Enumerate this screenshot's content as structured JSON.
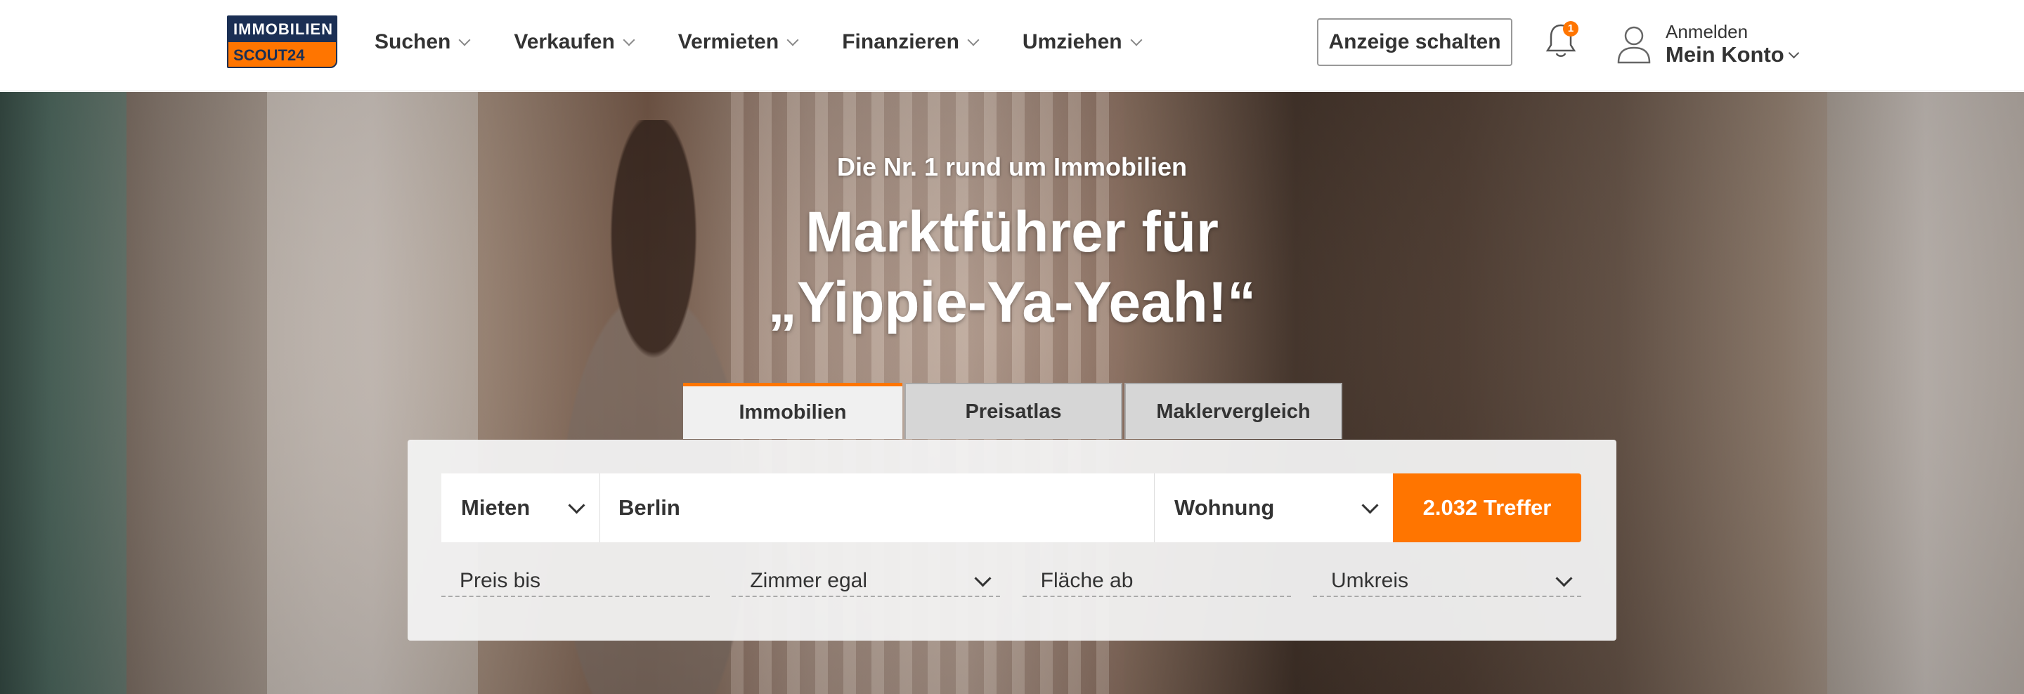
{
  "brand": {
    "logo_line1": "IMMOBILIEN",
    "logo_line2": "SCOUT24",
    "colors": {
      "orange": "#ff7500",
      "navy": "#1b2f54"
    }
  },
  "nav": [
    {
      "label": "Suchen"
    },
    {
      "label": "Verkaufen"
    },
    {
      "label": "Vermieten"
    },
    {
      "label": "Finanzieren"
    },
    {
      "label": "Umziehen"
    }
  ],
  "header": {
    "ad_button": "Anzeige schalten",
    "notification_count": "1",
    "account_small": "Anmelden",
    "account_big": "Mein Konto"
  },
  "hero": {
    "subtitle": "Die Nr. 1 rund um Immobilien",
    "title_line1": "Marktführer für",
    "title_line2": "„Yippie-Ya-Yeah!“"
  },
  "search": {
    "tabs": [
      {
        "label": "Immobilien",
        "active": true
      },
      {
        "label": "Preisatlas"
      },
      {
        "label": "Maklervergleich"
      }
    ],
    "mode": "Mieten",
    "location": "Berlin",
    "property_type": "Wohnung",
    "submit": "2.032 Treffer",
    "filters": {
      "price": "Preis bis",
      "rooms": "Zimmer egal",
      "area": "Fläche ab",
      "radius": "Umkreis"
    }
  }
}
